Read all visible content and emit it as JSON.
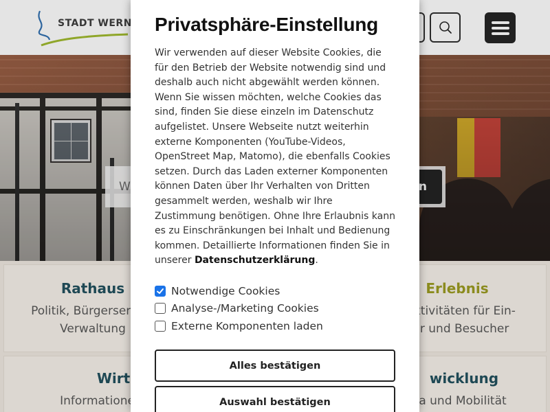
{
  "header": {
    "logo_text": "STADT WERNE"
  },
  "hero": {
    "search_placeholder_partial": "W",
    "search_button_partial": "n"
  },
  "tiles": [
    {
      "title": "Rathaus",
      "desc": "Politik, Bürgerservice\nVerwaltung",
      "color": "#1e4e5c"
    },
    {
      "title": "Erlebnis",
      "desc": "itaktivitäten für Ein-\nner und Besucher",
      "color": "#9a9a1e"
    },
    {
      "title": "Wirt",
      "desc": "Informationen fü",
      "color": "#1e4e5c"
    },
    {
      "title": "wicklung",
      "desc": "a und Mobilität",
      "color": "#1e4e5c"
    }
  ],
  "consent": {
    "title": "Privatsphäre-Einstellung",
    "body": "Wir verwenden auf dieser Website Cookies, die für den Betrieb der Website notwendig sind und deshalb auch nicht abgewählt werden können. Wenn Sie wissen möchten, welche Cookies das sind, finden Sie diese einzeln im Datenschutz aufgelistet. Unsere Webseite nutzt weiterhin externe Komponenten (YouTube-Videos, OpenStreet Map, Matomo), die ebenfalls Cookies setzen. Durch das Laden externer Komponenten können Daten über Ihr Verhalten von Dritten gesammelt werden, weshalb wir Ihre Zustimmung benötigen. Ohne Ihre Erlaubnis kann es zu Einschränkungen bei Inhalt und Bedienung kommen. Detaillierte Informationen finden Sie in unserer",
    "privacy_link": "Datenschutzerklärung",
    "privacy_suffix": ".",
    "options": [
      {
        "label": "Notwendige Cookies",
        "checked": true
      },
      {
        "label": "Analyse-/Marketing Cookies",
        "checked": false
      },
      {
        "label": "Externe Komponenten laden",
        "checked": false
      }
    ],
    "accept_all_label": "Alles bestätigen",
    "accept_selection_label": "Auswahl bestätigen"
  },
  "colors": {
    "accent": "#1a73e8",
    "dark": "#222222",
    "tile_blue": "#1e4e5c",
    "tile_olive": "#9a9a1e"
  }
}
